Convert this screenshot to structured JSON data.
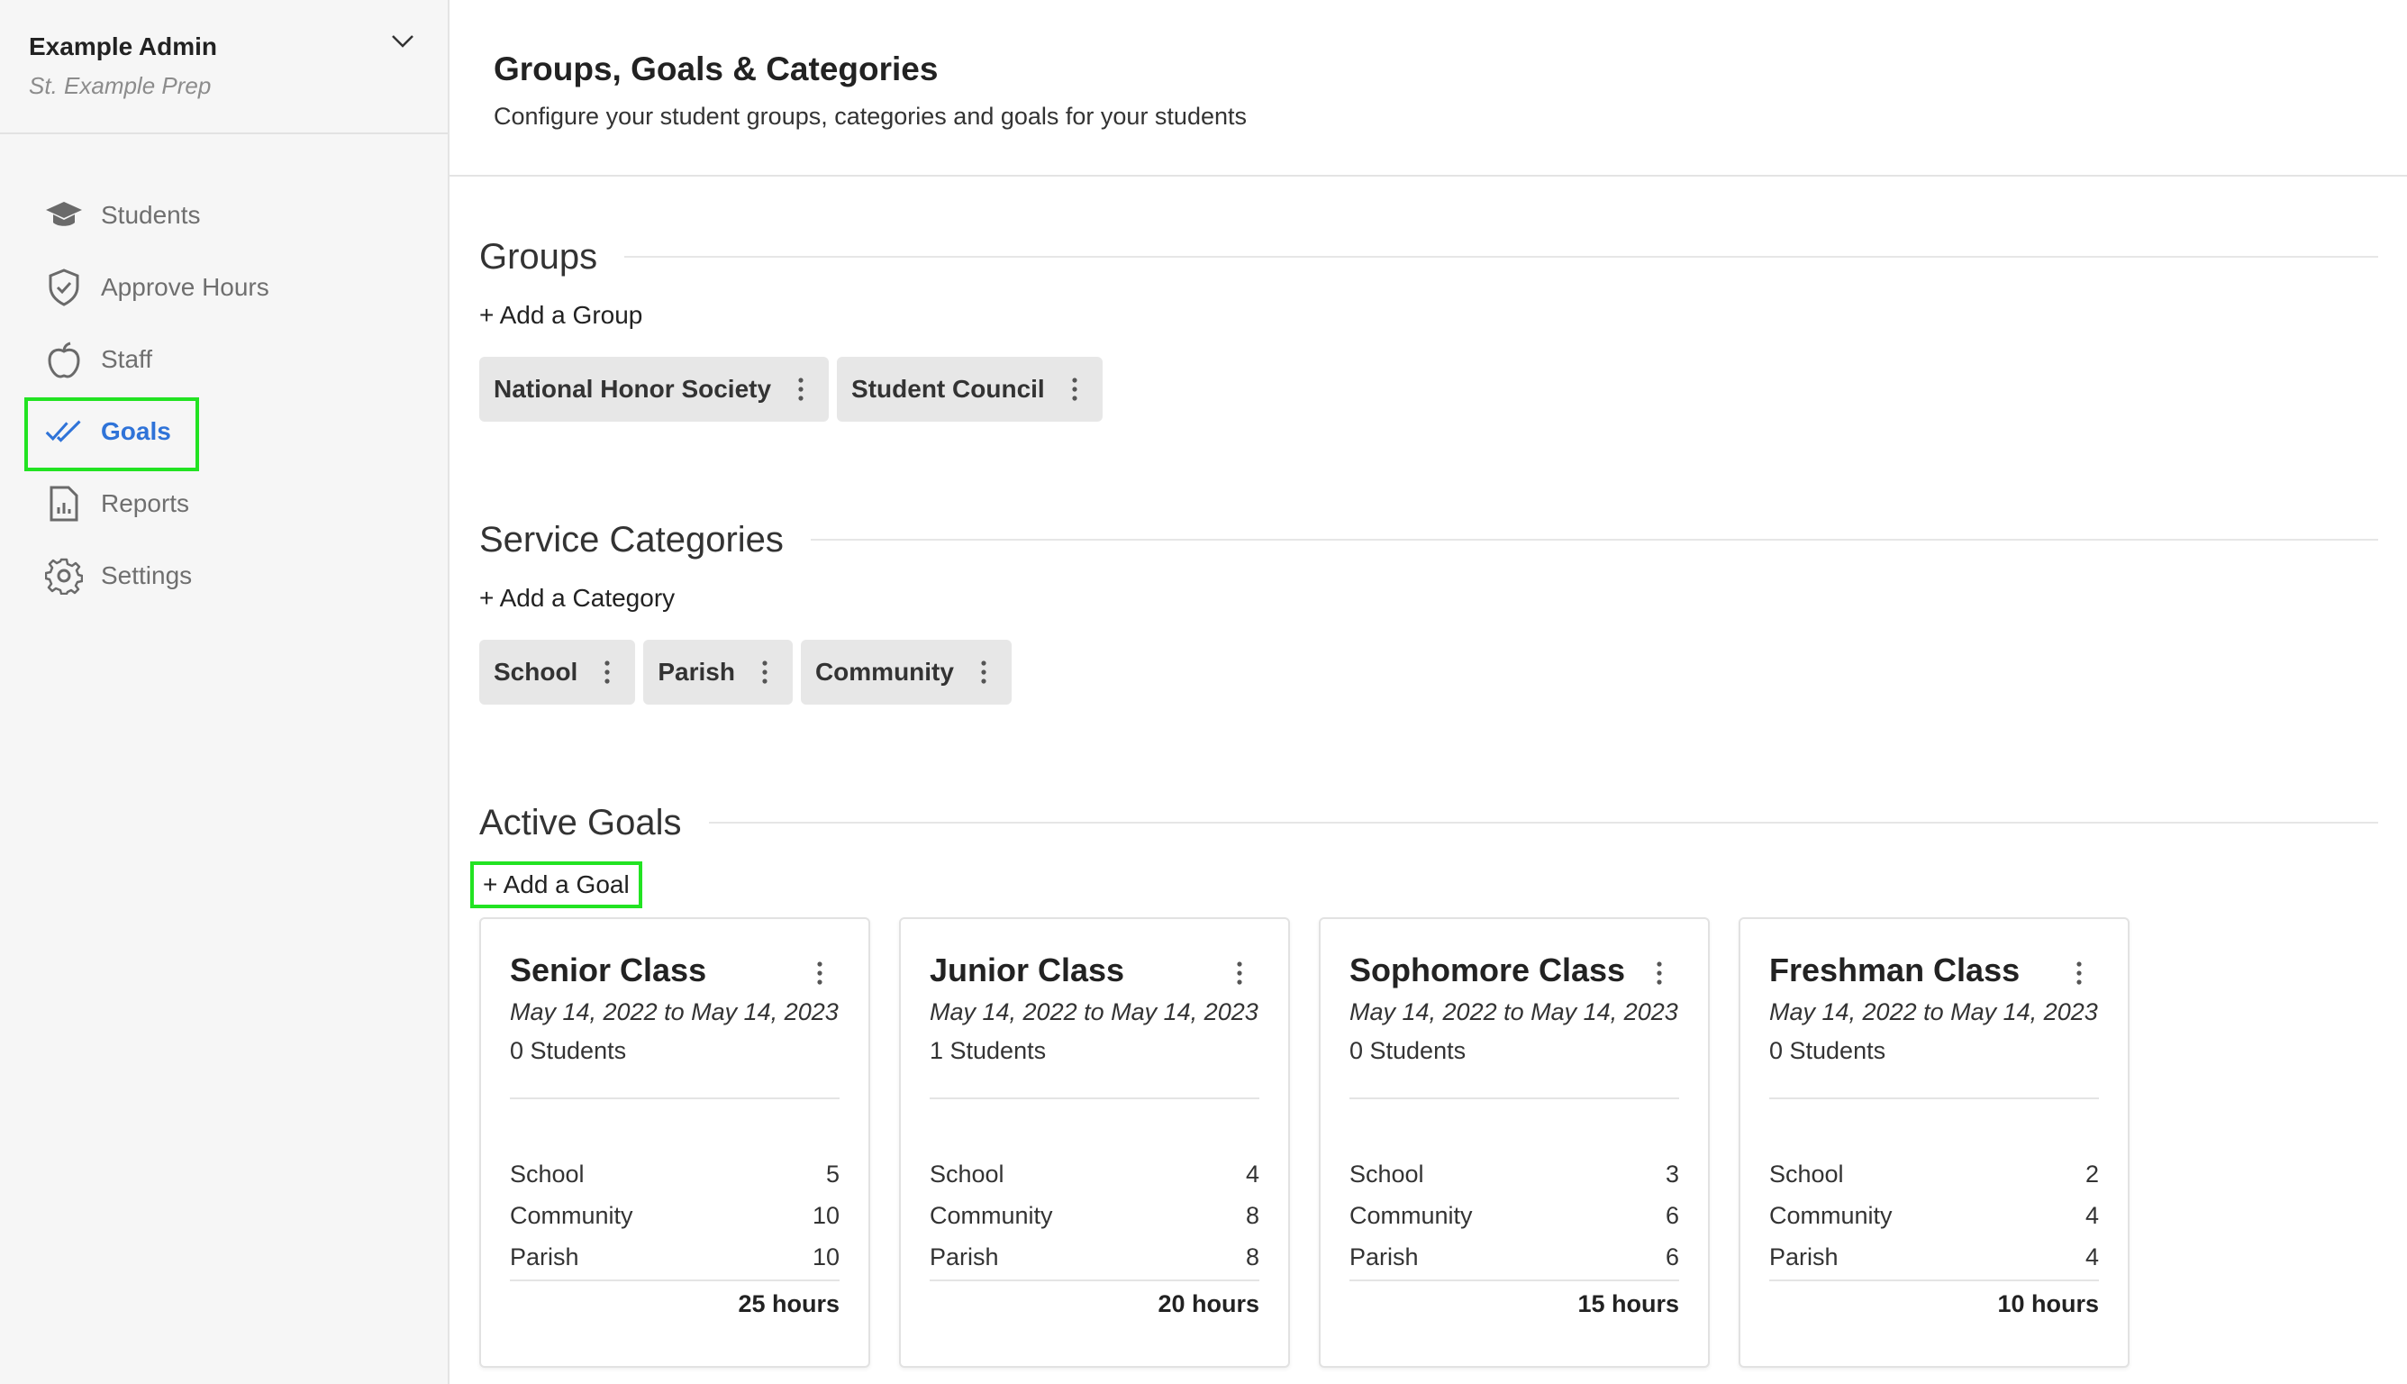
{
  "account": {
    "name": "Example Admin",
    "school": "St. Example Prep"
  },
  "nav": [
    {
      "label": "Students",
      "icon": "graduation-cap-icon"
    },
    {
      "label": "Approve Hours",
      "icon": "shield-check-icon"
    },
    {
      "label": "Staff",
      "icon": "apple-icon"
    },
    {
      "label": "Goals",
      "icon": "double-check-icon",
      "active": true
    },
    {
      "label": "Reports",
      "icon": "report-icon"
    },
    {
      "label": "Settings",
      "icon": "gear-icon"
    }
  ],
  "page": {
    "title": "Groups, Goals & Categories",
    "subtitle": "Configure your student groups, categories and goals for your students"
  },
  "groups": {
    "title": "Groups",
    "add_label": "+ Add a Group",
    "items": [
      "National Honor Society",
      "Student Council"
    ]
  },
  "categories": {
    "title": "Service Categories",
    "add_label": "+ Add a Category",
    "items": [
      "School",
      "Parish",
      "Community"
    ]
  },
  "goals": {
    "title": "Active Goals",
    "add_label": "+ Add a Goal",
    "cards": [
      {
        "title": "Senior Class",
        "dates": "May 14, 2022 to May 14, 2023",
        "students": "0 Students",
        "rows": [
          {
            "label": "School",
            "value": "5"
          },
          {
            "label": "Community",
            "value": "10"
          },
          {
            "label": "Parish",
            "value": "10"
          }
        ],
        "total": "25 hours"
      },
      {
        "title": "Junior Class",
        "dates": "May 14, 2022 to May 14, 2023",
        "students": "1 Students",
        "rows": [
          {
            "label": "School",
            "value": "4"
          },
          {
            "label": "Community",
            "value": "8"
          },
          {
            "label": "Parish",
            "value": "8"
          }
        ],
        "total": "20 hours"
      },
      {
        "title": "Sophomore Class",
        "dates": "May 14, 2022 to May 14, 2023",
        "students": "0 Students",
        "rows": [
          {
            "label": "School",
            "value": "3"
          },
          {
            "label": "Community",
            "value": "6"
          },
          {
            "label": "Parish",
            "value": "6"
          }
        ],
        "total": "15 hours"
      },
      {
        "title": "Freshman Class",
        "dates": "May 14, 2022 to May 14, 2023",
        "students": "0 Students",
        "rows": [
          {
            "label": "School",
            "value": "2"
          },
          {
            "label": "Community",
            "value": "4"
          },
          {
            "label": "Parish",
            "value": "4"
          }
        ],
        "total": "10 hours"
      }
    ]
  },
  "colors": {
    "accent": "#2f73d8",
    "highlight": "#22e322",
    "chip_bg": "#e7e7e7",
    "sidebar_bg": "#f6f6f6"
  }
}
